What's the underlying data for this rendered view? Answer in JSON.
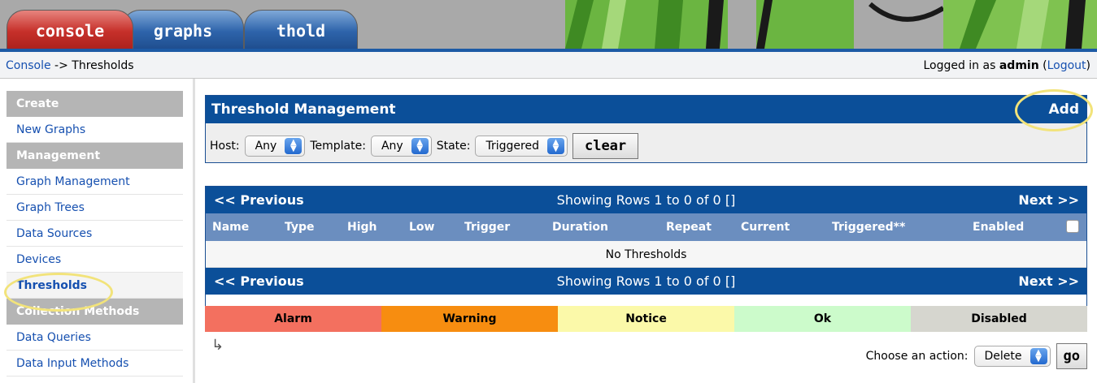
{
  "tabs": [
    {
      "label": "console"
    },
    {
      "label": "graphs"
    },
    {
      "label": "thold"
    }
  ],
  "breadcrumb": {
    "console_link": "Console",
    "separator": " -> ",
    "current": "Thresholds"
  },
  "login": {
    "prefix": "Logged in as ",
    "user": "admin",
    "logout_link": "Logout"
  },
  "sidebar": {
    "sections": [
      {
        "header": "Create",
        "items": [
          "New Graphs"
        ]
      },
      {
        "header": "Management",
        "items": [
          "Graph Management",
          "Graph Trees",
          "Data Sources",
          "Devices",
          "Thresholds"
        ]
      },
      {
        "header": "Collection Methods",
        "items": [
          "Data Queries",
          "Data Input Methods"
        ]
      }
    ],
    "selected": "Thresholds"
  },
  "management": {
    "title": "Threshold Management",
    "add_label": "Add",
    "filters": {
      "host_label": "Host:",
      "host_value": "Any",
      "template_label": "Template:",
      "template_value": "Any",
      "state_label": "State:",
      "state_value": "Triggered",
      "clear_label": "clear"
    }
  },
  "results": {
    "prev_label": "<< Previous",
    "next_label": "Next >>",
    "showing": "Showing Rows 1 to 0 of 0 []",
    "columns": [
      "Name",
      "Type",
      "High",
      "Low",
      "Trigger",
      "Duration",
      "Repeat",
      "Current",
      "Triggered**",
      "Enabled"
    ],
    "empty_message": "No Thresholds"
  },
  "legend": [
    {
      "label": "Alarm",
      "color": "#f3705f"
    },
    {
      "label": "Warning",
      "color": "#f78d10"
    },
    {
      "label": "Notice",
      "color": "#fbf9a9"
    },
    {
      "label": "Ok",
      "color": "#ccfbcb"
    },
    {
      "label": "Disabled",
      "color": "#d6d6cf"
    }
  ],
  "actions": {
    "choose_label": "Choose an action:",
    "selected_action": "Delete",
    "go_label": "go"
  },
  "colors": {
    "header_blue": "#0b4f99",
    "column_blue": "#6b8ebf",
    "link_blue": "#1650b0",
    "highlight_ring": "#f2e37a"
  }
}
